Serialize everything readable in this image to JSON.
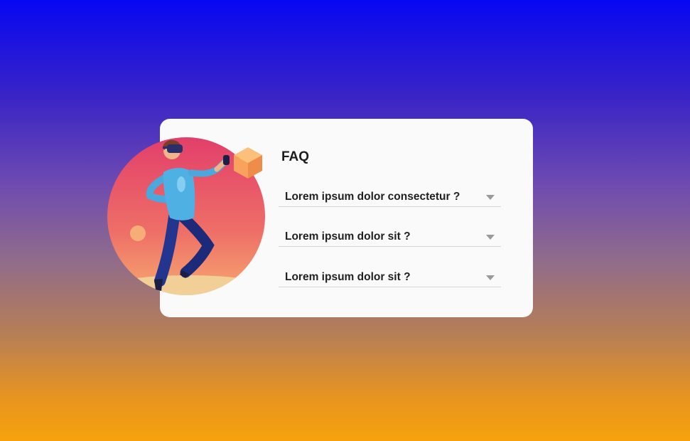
{
  "faq": {
    "title": "FAQ",
    "items": [
      {
        "question": "Lorem ipsum dolor consectetur ?",
        "icon": "caret-down-icon"
      },
      {
        "question": "Lorem ipsum dolor sit ?",
        "icon": "caret-down-icon"
      },
      {
        "question": "Lorem ipsum dolor sit ?",
        "icon": "caret-down-icon"
      }
    ]
  },
  "illustration": {
    "subject": "vr-player-illustration",
    "colors": {
      "circle_top": "#e23f6a",
      "circle_bottom": "#f6a06e",
      "shirt": "#4fb0e4",
      "pants": "#1d2a7a",
      "cube": "#f8a25e"
    }
  },
  "background": {
    "gradient_top": "#0707f2",
    "gradient_bottom": "#f7a20c"
  }
}
